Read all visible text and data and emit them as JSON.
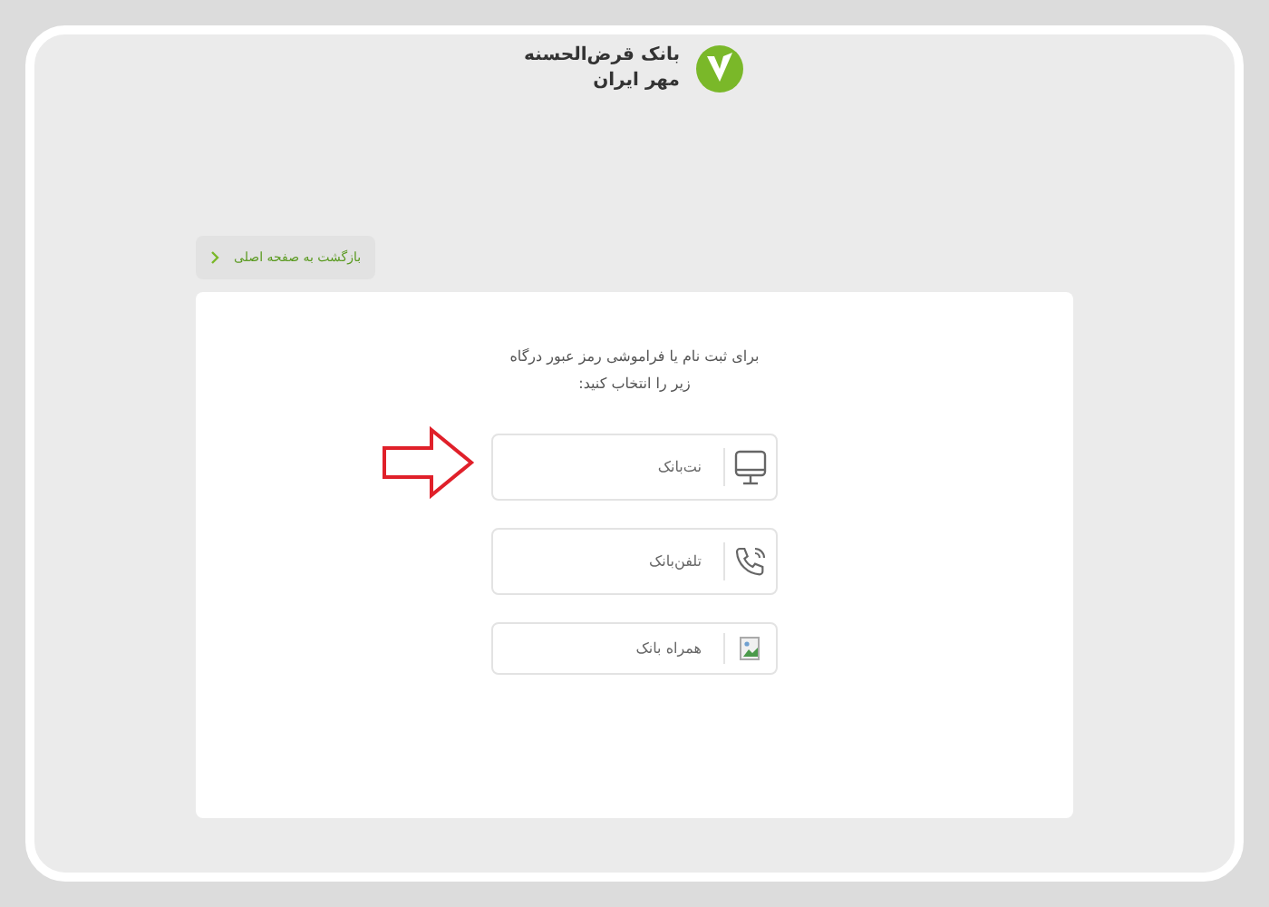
{
  "logo": {
    "line_1": "بانک قرض‌الحسنه",
    "line_2": "مهر ایران"
  },
  "back_link": {
    "label": "بازگشت به صفحه اصلی"
  },
  "instruction": "برای ثبت نام یا فراموشی رمز عبور درگاه زیر را انتخاب کنید:",
  "options": [
    {
      "kind": "computer",
      "label": "نت‌بانک"
    },
    {
      "kind": "phone",
      "label": "تلفن‌بانک"
    },
    {
      "kind": "image",
      "label": "همراه بانک"
    }
  ]
}
